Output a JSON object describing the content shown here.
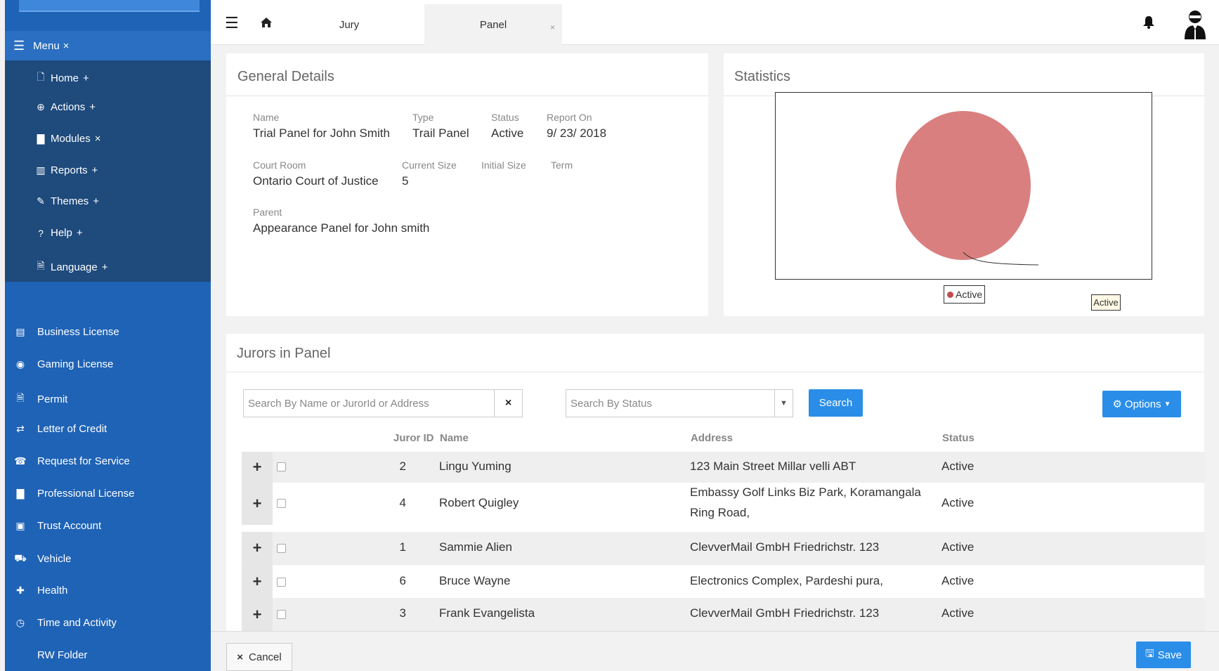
{
  "sidebar": {
    "menu_label": "Menu",
    "menu_toggle": "×",
    "sub_items": [
      {
        "label": "Home",
        "toggle": "+",
        "icon": "file-icon"
      },
      {
        "label": "Actions",
        "toggle": "+",
        "icon": "plus-circle-icon"
      },
      {
        "label": "Modules",
        "toggle": "×",
        "icon": "briefcase-icon"
      },
      {
        "label": "Reports",
        "toggle": "+",
        "icon": "bar-chart-icon"
      },
      {
        "label": "Themes",
        "toggle": "+",
        "icon": "brush-icon"
      },
      {
        "label": "Help",
        "toggle": "+",
        "icon": "question-circle-icon"
      },
      {
        "label": "Language",
        "toggle": "+",
        "icon": "translate-icon"
      }
    ],
    "modules": [
      {
        "label": "Business License",
        "icon": "document-icon"
      },
      {
        "label": "Gaming License",
        "icon": "gamepad-icon"
      },
      {
        "label": "Permit",
        "icon": "file-check-icon"
      },
      {
        "label": "Letter of Credit",
        "icon": "credit-icon"
      },
      {
        "label": "Request for Service",
        "icon": "phone-icon"
      },
      {
        "label": "Professional License",
        "icon": "briefcase-icon"
      },
      {
        "label": "Trust Account",
        "icon": "money-icon"
      },
      {
        "label": "Vehicle",
        "icon": "truck-icon"
      },
      {
        "label": "Health",
        "icon": "medkit-icon"
      },
      {
        "label": "Time and Activity",
        "icon": "clock-icon"
      },
      {
        "label": "RW Folder",
        "icon": ""
      }
    ]
  },
  "header": {
    "tabs": [
      {
        "label": "Jury",
        "active": false
      },
      {
        "label": "Panel",
        "active": true,
        "close": "×"
      }
    ]
  },
  "general": {
    "title": "General Details",
    "name_label": "Name",
    "name_value": "Trial Panel for John Smith",
    "type_label": "Type",
    "type_value": "Trail Panel",
    "status_label": "Status",
    "status_value": "Active",
    "report_label": "Report On",
    "report_value": "9/ 23/ 2018",
    "court_label": "Court Room",
    "court_value": "Ontario Court of Justice",
    "current_size_label": "Current Size",
    "current_size_value": "5",
    "initial_size_label": "Initial Size",
    "term_label": "Term",
    "parent_label": "Parent",
    "parent_value": "Appearance Panel for John smith"
  },
  "statistics": {
    "title": "Statistics",
    "callout": "Active",
    "legend_label": "Active",
    "slice_color": "#d97f7f"
  },
  "chart_data": {
    "type": "pie",
    "categories": [
      "Active"
    ],
    "values": [
      1
    ],
    "legend": "bottom"
  },
  "jurors": {
    "title": "Jurors in Panel",
    "search_placeholder": "Search By Name or JurorId or Address",
    "clear_icon": "×",
    "status_placeholder": "Search By Status",
    "search_button": "Search",
    "options_button": "Options",
    "columns": {
      "id": "Juror ID",
      "name": "Name",
      "address": "Address",
      "status": "Status"
    },
    "rows": [
      {
        "id": "2",
        "name": "Lingu Yuming",
        "address1": "123 Main Street Millar velli ABT",
        "address2": "",
        "status": "Active"
      },
      {
        "id": "4",
        "name": "Robert Quigley",
        "address1": "Embassy Golf Links Biz Park, Koramangala",
        "address2": "Ring Road,",
        "status": "Active"
      },
      {
        "id": "1",
        "name": "Sammie Alien",
        "address1": "ClevverMail GmbH Friedrichstr. 123",
        "address2": "",
        "status": "Active"
      },
      {
        "id": "6",
        "name": "Bruce Wayne",
        "address1": "Electronics Complex, Pardeshi pura,",
        "address2": "",
        "status": "Active"
      },
      {
        "id": "3",
        "name": "Frank Evangelista",
        "address1": "ClevverMail GmbH Friedrichstr. 123",
        "address2": "",
        "status": "Active"
      }
    ]
  },
  "footer": {
    "cancel": "Cancel",
    "save": "Save"
  },
  "colors": {
    "sidebar": "#1f63b6",
    "submenu": "#1e4a7c",
    "accent": "#2a8ee8"
  }
}
